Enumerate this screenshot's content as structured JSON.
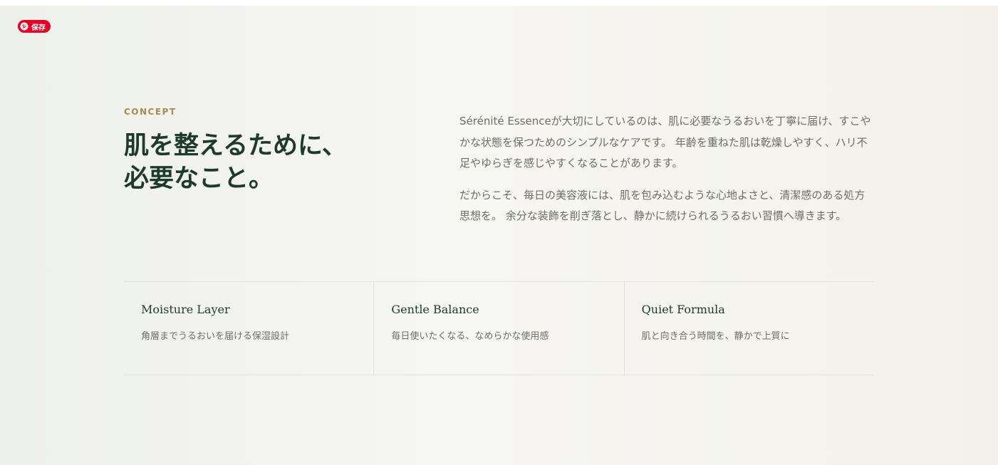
{
  "pin_button": {
    "label": "保存",
    "icon": "pinterest-icon",
    "color": "#e60023"
  },
  "concept": {
    "eyebrow": "CONCEPT",
    "heading": "肌を整えるために、\n必要なこと。",
    "paragraphs": [
      "Sérénité Essenceが大切にしているのは、肌に必要なうるおいを丁寧に届け、すこやかな状態を保つためのシンプルなケアです。 年齢を重ねた肌は乾燥しやすく、ハリ不足やゆらぎを感じやすくなることがあります。",
      "だからこそ、毎日の美容液には、肌を包み込むような心地よさと、清潔感のある処方思想を。 余分な装飾を削ぎ落とし、静かに続けられるうるおい習慣へ導きます。"
    ]
  },
  "features": [
    {
      "title": "Moisture Layer",
      "description": "角層までうるおいを届ける保湿設計"
    },
    {
      "title": "Gentle Balance",
      "description": "毎日使いたくなる、なめらかな使用感"
    },
    {
      "title": "Quiet Formula",
      "description": "肌と向き合う時間を、静かで上質に"
    }
  ],
  "colors": {
    "accent_gold": "#a88a4e",
    "heading_green": "#1d3b2c",
    "body_gray": "#6d6d68"
  }
}
